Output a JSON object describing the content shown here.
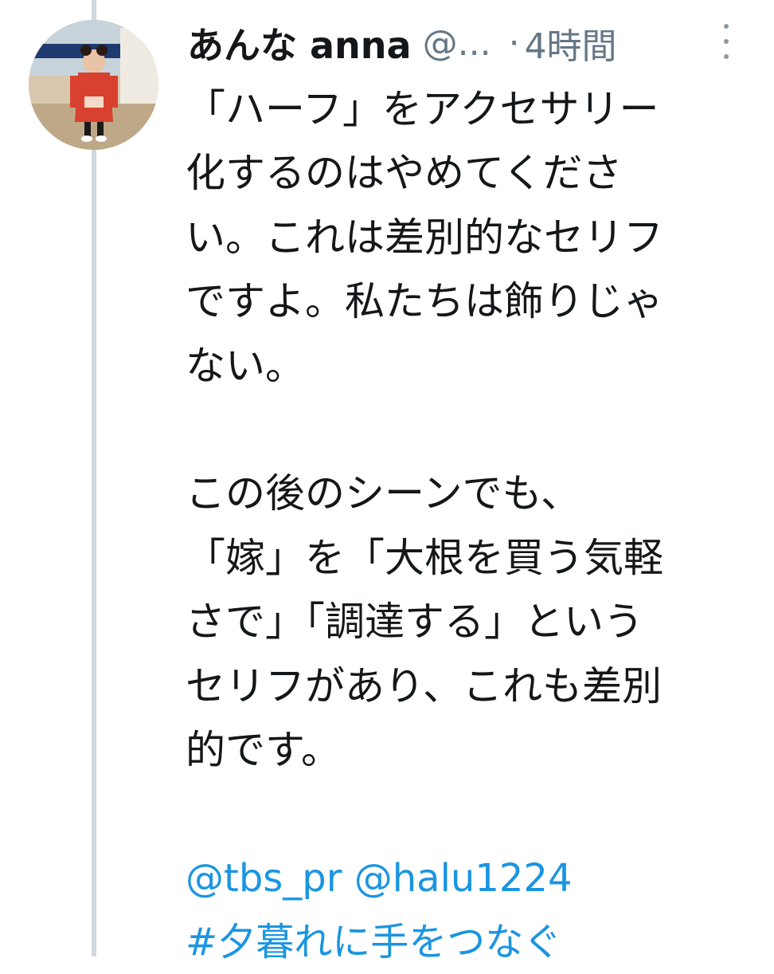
{
  "tweet": {
    "display_name": "あんな anna",
    "handle": "@...",
    "separator": "·",
    "time": "4時間",
    "body_lines": [
      "「ハーフ」をアクセサリー",
      "化するのはやめてくださ",
      "い。これは差別的なセリフ",
      "ですよ。私たちは飾りじゃ",
      "ない。",
      "",
      "この後のシーンでも、",
      "「嫁」を「大根を買う気軽",
      "さで」「調達する」という",
      "セリフがあり、これも差別",
      "的です。",
      ""
    ],
    "mentions": "@tbs_pr @halu1224",
    "hashtag": "#夕暮れに手をつなぐ"
  },
  "colors": {
    "text": "#14171a",
    "secondary": "#657786",
    "link": "#1b95e0",
    "thread_line": "#cfd9de"
  },
  "icons": {
    "more": "more-vertical-icon"
  }
}
